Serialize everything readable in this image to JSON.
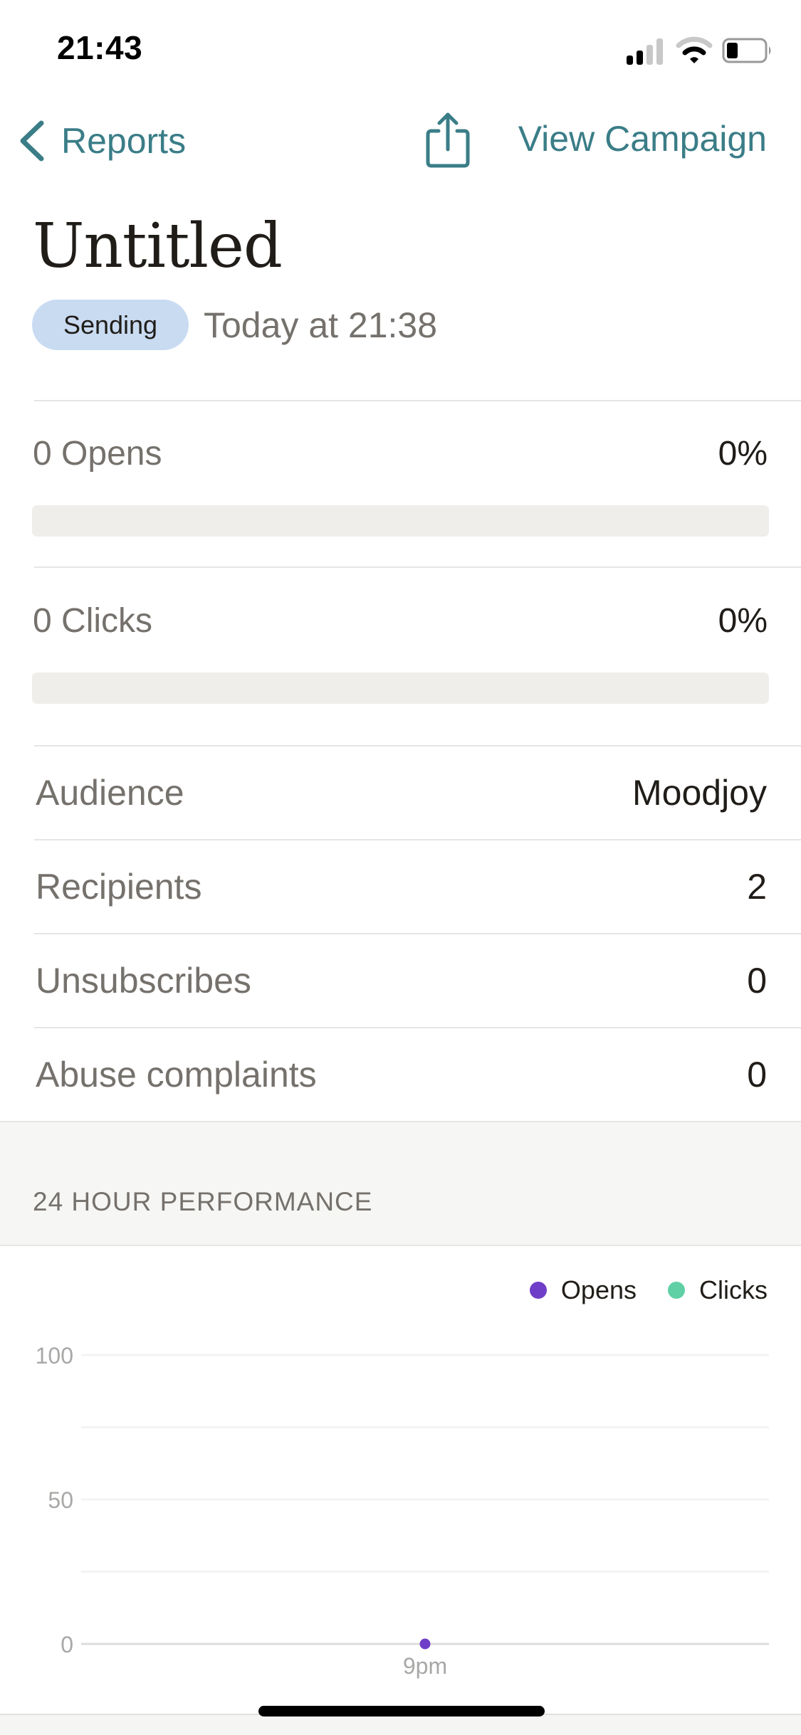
{
  "status_bar": {
    "time": "21:43",
    "signal_bars": 2,
    "signal_bars_total": 4,
    "wifi_level": 2,
    "battery_percent": 30
  },
  "nav": {
    "back_label": "Reports",
    "back_icon": "chevron-left-icon",
    "share_icon": "share-icon",
    "view_campaign_label": "View Campaign"
  },
  "campaign": {
    "title": "Untitled",
    "status_badge": "Sending",
    "sent_time": "Today at 21:38"
  },
  "metrics": [
    {
      "label": "0 Opens",
      "percent_label": "0%",
      "percent": 0
    },
    {
      "label": "0 Clicks",
      "percent_label": "0%",
      "percent": 0
    }
  ],
  "details": [
    {
      "label": "Audience",
      "value": "Moodjoy"
    },
    {
      "label": "Recipients",
      "value": "2"
    },
    {
      "label": "Unsubscribes",
      "value": "0"
    },
    {
      "label": "Abuse complaints",
      "value": "0"
    }
  ],
  "performance": {
    "section_title": "24 HOUR PERFORMANCE"
  },
  "colors": {
    "accent": "#3a7d87",
    "opens": "#6f3ec8",
    "clicks": "#5fd0a6",
    "badge_bg": "#c9dbf1"
  },
  "chart_data": {
    "type": "line",
    "title": "24 HOUR PERFORMANCE",
    "xlabel": "",
    "ylabel": "",
    "ylim": [
      0,
      100
    ],
    "yticks": [
      0,
      50,
      100
    ],
    "gridlines": [
      0,
      25,
      50,
      75,
      100
    ],
    "grid": true,
    "legend_position": "top-right",
    "x": [
      "9pm"
    ],
    "series": [
      {
        "name": "Opens",
        "color": "#6f3ec8",
        "values": [
          0
        ]
      },
      {
        "name": "Clicks",
        "color": "#5fd0a6",
        "values": []
      }
    ]
  }
}
